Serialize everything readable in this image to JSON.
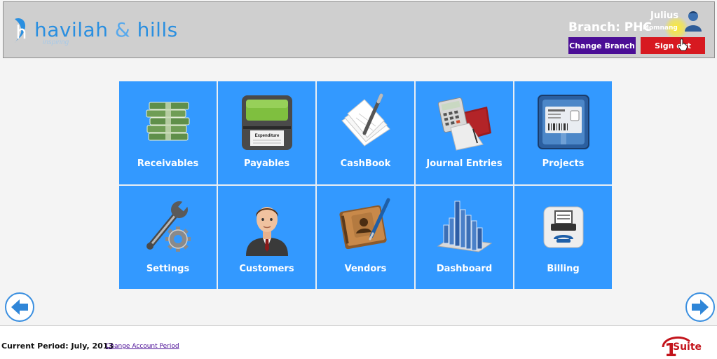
{
  "header": {
    "logo_text_a": "havilah",
    "logo_amp": "&",
    "logo_text_b": "hills",
    "logo_tagline": "inspiring",
    "branch_label": "Branch: PHC",
    "user_first": "Julius",
    "user_last": "Momnang",
    "change_branch_label": "Change Branch",
    "sign_out_label": "Sign out"
  },
  "tiles": [
    {
      "label": "Receivables",
      "icon": "money-stack-icon"
    },
    {
      "label": "Payables",
      "icon": "expenditure-printer-icon"
    },
    {
      "label": "CashBook",
      "icon": "papers-pen-icon"
    },
    {
      "label": "Journal Entries",
      "icon": "calculator-journal-icon"
    },
    {
      "label": "Projects",
      "icon": "shipping-box-icon"
    },
    {
      "label": "Settings",
      "icon": "wrench-gear-icon"
    },
    {
      "label": "Customers",
      "icon": "businessman-icon"
    },
    {
      "label": "Vendors",
      "icon": "address-book-icon"
    },
    {
      "label": "Dashboard",
      "icon": "bar-chart-icon"
    },
    {
      "label": "Billing",
      "icon": "fax-machine-icon"
    }
  ],
  "payables_icon_caption": "Expenditure",
  "footer": {
    "current_period": "Current Period: July, 2013",
    "change_period_link": "Change Account Period",
    "brand_number": "1",
    "brand_suite": "Suite"
  },
  "colors": {
    "tile_blue": "#3399ff",
    "header_gray": "#cfcfcf",
    "change_branch_purple": "#4b0e96",
    "sign_out_red": "#d71920"
  }
}
